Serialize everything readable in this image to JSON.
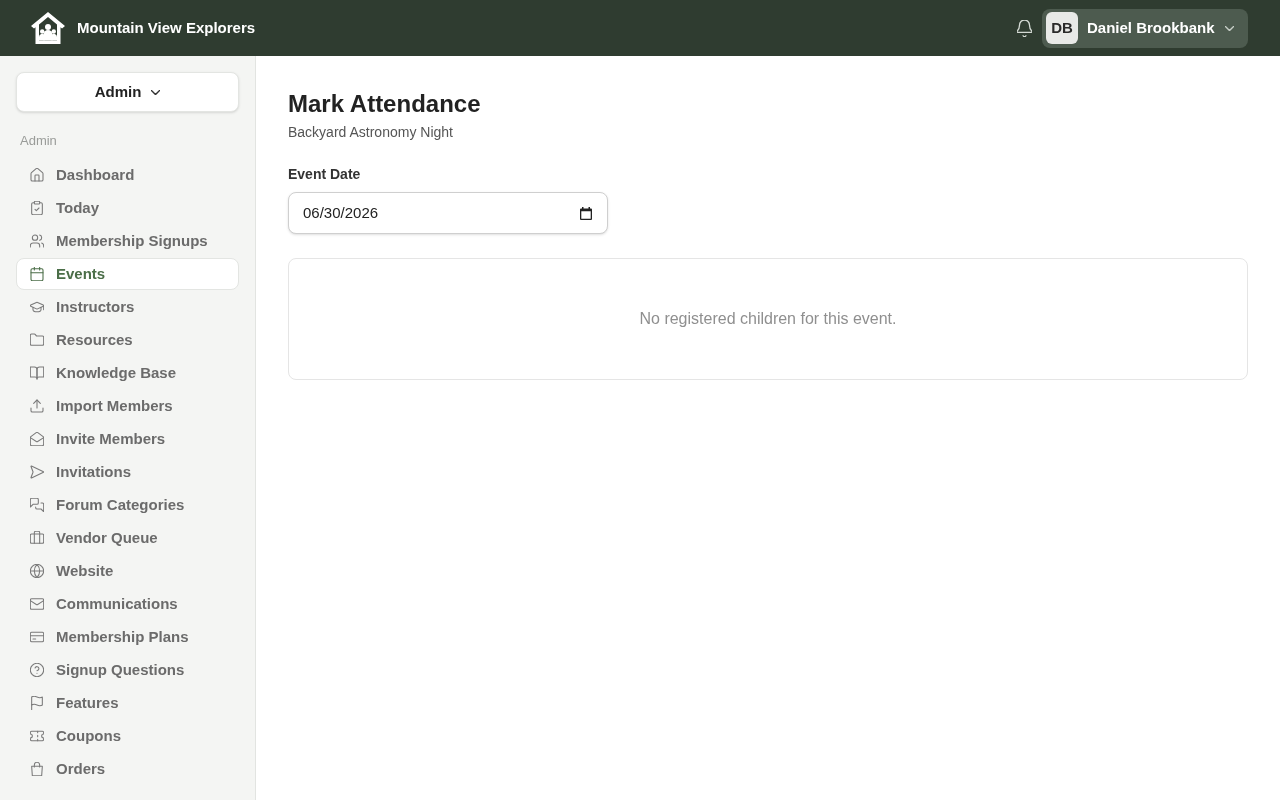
{
  "header": {
    "brand": "Mountain View Explorers",
    "user": {
      "initials": "DB",
      "name": "Daniel Brookbank"
    }
  },
  "sidebar": {
    "role_switcher": "Admin",
    "section_label": "Admin",
    "items": [
      {
        "label": "Dashboard",
        "selected": false
      },
      {
        "label": "Today",
        "selected": false
      },
      {
        "label": "Membership Signups",
        "selected": false
      },
      {
        "label": "Events",
        "selected": true
      },
      {
        "label": "Instructors",
        "selected": false
      },
      {
        "label": "Resources",
        "selected": false
      },
      {
        "label": "Knowledge Base",
        "selected": false
      },
      {
        "label": "Import Members",
        "selected": false
      },
      {
        "label": "Invite Members",
        "selected": false
      },
      {
        "label": "Invitations",
        "selected": false
      },
      {
        "label": "Forum Categories",
        "selected": false
      },
      {
        "label": "Vendor Queue",
        "selected": false
      },
      {
        "label": "Website",
        "selected": false
      },
      {
        "label": "Communications",
        "selected": false
      },
      {
        "label": "Membership Plans",
        "selected": false
      },
      {
        "label": "Signup Questions",
        "selected": false
      },
      {
        "label": "Features",
        "selected": false
      },
      {
        "label": "Coupons",
        "selected": false
      },
      {
        "label": "Orders",
        "selected": false
      }
    ]
  },
  "page": {
    "title": "Mark Attendance",
    "subtitle": "Backyard Astronomy Night",
    "date_field": {
      "label": "Event Date",
      "value": "06/30/2026"
    },
    "empty_state": "No registered children for this event."
  }
}
